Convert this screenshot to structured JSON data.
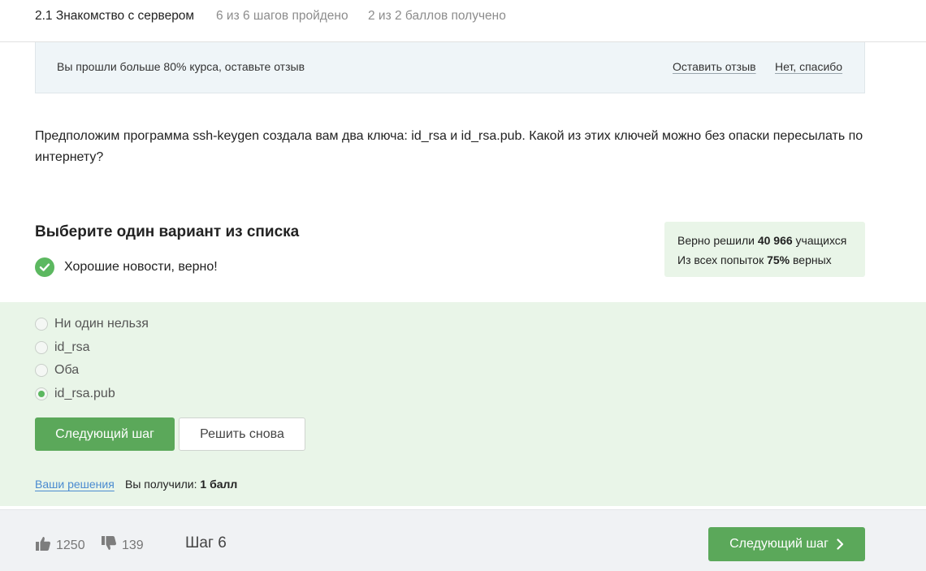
{
  "header": {
    "title": "2.1 Знакомство с сервером",
    "steps_progress": "6 из 6 шагов пройдено",
    "points_progress": "2 из 2 баллов  получено"
  },
  "notice": {
    "text": "Вы прошли больше 80% курса, оставьте отзыв",
    "feedback_link": "Оставить отзыв",
    "dismiss_link": "Нет, спасибо"
  },
  "question": {
    "text": "Предположим программа ssh-keygen создала вам два ключа: id_rsa и id_rsa.pub. Какой из этих ключей можно без опаски пересылать по интернету?"
  },
  "quiz": {
    "title": "Выберите один вариант из списка",
    "result_message": "Хорошие новости, верно!",
    "options": [
      {
        "label": "Ни один нельзя",
        "selected": false
      },
      {
        "label": "id_rsa",
        "selected": false
      },
      {
        "label": "Оба",
        "selected": false
      },
      {
        "label": "id_rsa.pub",
        "selected": true
      }
    ],
    "next_button": "Следующий шаг",
    "retry_button": "Решить снова",
    "solutions_link": "Ваши решения",
    "score_prefix": "Вы получили:",
    "score_value": "1 балл"
  },
  "stats": {
    "solved_prefix": "Верно решили",
    "solved_count": "40 966",
    "solved_suffix": "учащихся",
    "attempts_prefix": "Из всех попыток",
    "attempts_percent": "75%",
    "attempts_suffix": "верных"
  },
  "footer": {
    "likes": "1250",
    "dislikes": "139",
    "step_label": "Шаг 6",
    "next_button": "Следующий шаг"
  },
  "colors": {
    "accent_green": "#5ba85a",
    "success_bg": "#e9f5e8",
    "link_blue": "#4b8bd0"
  },
  "icons": {
    "result": "check-circle-icon",
    "like": "thumbs-up-icon",
    "dislike": "thumbs-down-icon",
    "next": "chevron-right-icon"
  }
}
